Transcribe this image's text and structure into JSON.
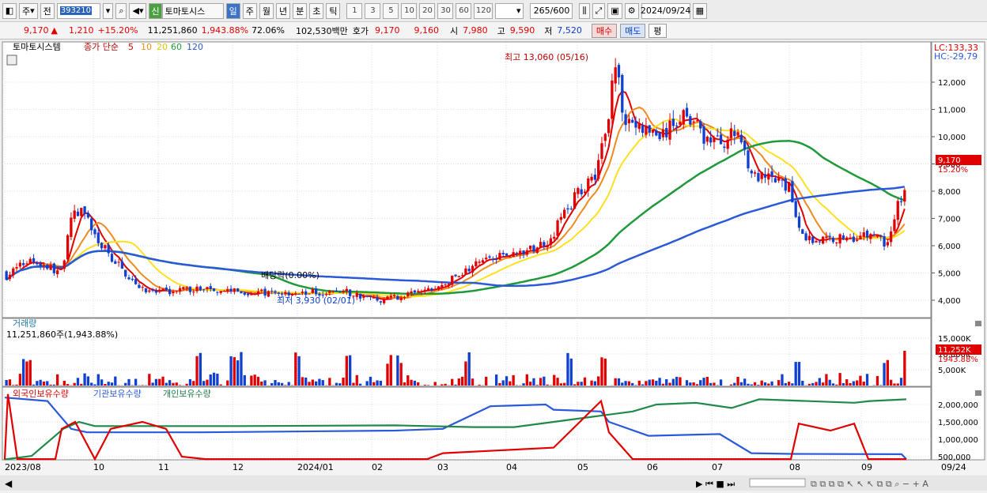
{
  "toolbar": {
    "market": "주",
    "mode": "전",
    "code": "393210",
    "name": "토마토시스",
    "sin": "신",
    "periods": [
      "일",
      "주",
      "월",
      "년",
      "분",
      "초",
      "틱"
    ],
    "intervals": [
      "1",
      "3",
      "5",
      "10",
      "20",
      "30",
      "60",
      "120"
    ],
    "count": "265",
    "count_max": "/600",
    "date": "2024/09/24"
  },
  "quote": {
    "price": "9,170",
    "arrow": "▲",
    "change": "1,210",
    "rate": "+15.20%",
    "volume": "11,251,860",
    "vol_rate": "1,943.88%",
    "turnover": "72.06%",
    "amount": "102,530백만",
    "hoga_label": "호가",
    "ask": "9,170",
    "bid": "9,160",
    "open_label": "시",
    "open": "7,980",
    "high_label": "고",
    "high": "9,590",
    "low_label": "저",
    "low": "7,520",
    "buy": "매수",
    "sell": "매도",
    "avg": "평"
  },
  "main_legend": {
    "name": "토마토시스템",
    "type": "종가 단순",
    "ma": [
      "5",
      "10",
      "20",
      "60",
      "120"
    ]
  },
  "colors": {
    "up": "#e00000",
    "down": "#1040d0",
    "ma5": "#e00000",
    "ma10": "#ef8a1e",
    "ma20": "#ffe020",
    "ma60": "#1f9a3a",
    "ma120": "#2a5ad8"
  },
  "lc": "LC:133,33",
  "hc": "HC:-29,79",
  "annotations": {
    "high": "최고 13,060 (05/16)",
    "low": "최저 3,930 (02/01)",
    "div": "배당락(0.00%)"
  },
  "price_axis": [
    "12,000",
    "11,000",
    "10,000",
    "9,000",
    "8,000",
    "7,000",
    "6,000",
    "5,000",
    "4,000"
  ],
  "price_badge": "9,170",
  "price_badge2": "15.20%",
  "vol_title": "거래량",
  "vol_value": "11,251,860주(1,943.88%)",
  "vol_axis": [
    "15,000K",
    "10,000K",
    "5,000K"
  ],
  "vol_badge": "11,252K",
  "vol_badge2": "1943.88%",
  "hold_legend": [
    "외국인보유수량",
    "기관보유수량",
    "개인보유수량"
  ],
  "hold_axis": [
    "2,000,000",
    "1,500,000",
    "1,000,000",
    "500,000"
  ],
  "date_axis": [
    "2023/08",
    "10",
    "11",
    "12",
    "2024/01",
    "02",
    "03",
    "04",
    "05",
    "06",
    "07",
    "08",
    "09",
    "09/24"
  ]
}
